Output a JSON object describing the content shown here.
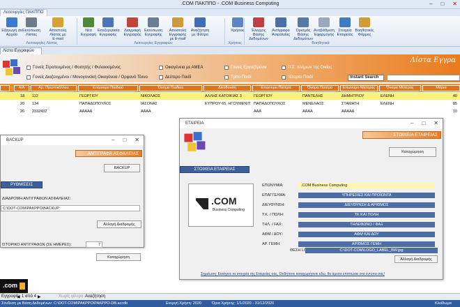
{
  "window": {
    "title": ".COM ΠΑΚΠΠΟ - .COM Business Computing"
  },
  "ribbon_tab": "Λειτουργίες ΠΑΚΠΠΟ",
  "ribbon": {
    "buttons": [
      {
        "label": "Εξαγωγή σε Αρχείο",
        "icon": "export-icon",
        "color": "#3b7ad0"
      },
      {
        "label": "Εκτύπωση Λίστας",
        "icon": "printer-icon",
        "color": "#6d7b8a"
      },
      {
        "label": "Αποστολή Λίστας με E-mail",
        "icon": "email-icon",
        "color": "#d8a233"
      },
      {
        "label": "Νέα Εγγραφή",
        "icon": "new-user-icon",
        "color": "#4c8a3a"
      },
      {
        "label": "Επεξεργασία Εγγραφής",
        "icon": "edit-user-icon",
        "color": "#4f74b5"
      },
      {
        "label": "Διαγραφή Εγγραφής",
        "icon": "delete-user-icon",
        "color": "#c0463b"
      },
      {
        "label": "Εκτύπωση Εγγραφής",
        "icon": "print-record-icon",
        "color": "#6b7d95"
      },
      {
        "label": "Αποστολή Εγγραφής με E-mail",
        "icon": "send-record-icon",
        "color": "#d09a3b"
      },
      {
        "label": "Αναζήτηση με Φίλτρο",
        "icon": "filter-search-icon",
        "color": "#3e6fb5"
      },
      {
        "label": "Χρήσεις",
        "icon": "years-icon",
        "color": "#5f84c6"
      },
      {
        "label": "Έλεγχος Βάσης Δεδομένων",
        "icon": "db-check-icon",
        "color": "#c23f3f"
      },
      {
        "label": "Αντίγραφο Ασφαλείας",
        "icon": "backup-icon",
        "color": "#4a6fa8"
      },
      {
        "label": "Ορισμός Βάσης Δεδομένων",
        "icon": "db-define-icon",
        "color": "#557aa8"
      },
      {
        "label": "Αναβάθμιση Εφαρμογής",
        "icon": "upgrade-icon",
        "color": "#9aa9bb"
      },
      {
        "label": "Στοιχεία Εταιρείας",
        "icon": "company-icon",
        "color": "#3f7bc4"
      },
      {
        "label": "Βοηθητικές Φόρμες",
        "icon": "forms-icon",
        "color": "#d19b37"
      }
    ],
    "groups": [
      "Λειτουργίες Λίστας",
      "Λειτουργίες Εγγραφών",
      "Χρήσεις",
      "Βοηθητικά"
    ]
  },
  "doc_tab": "Λίστα Εγγραφών",
  "list_title": "Λίστα Εγγρα",
  "filters": [
    "Γονείς Στρατευμένος / Φοιτητής / Φυλακισμένος",
    "Οικογένεια με ΑΜΕΑ",
    "Γονείς Εργαζόμενοι",
    "Π.Σ. πλήρων της Οικίας",
    "Γονείς Διαζευγμένοι / Μονογονεϊκή Οικογένεια / Ορφανό Τέκνο",
    "Δεύτερο Παιδί",
    "Τρίτο Παιδί",
    "Τέταρτο Παιδί"
  ],
  "instant_search_label": "Instant Search",
  "table": {
    "headers": [
      "Α/Α",
      "Αρ. Πρωτοκόλλου",
      "Επώνυμο Παιδιού",
      "Όνομα Παιδιού",
      "Διεύθυνση",
      "Επώνυμο Πατέρα",
      "Όνομα Πατέρα",
      "Επώνυμο Μητέρας",
      "Όνομα Μητέρας",
      "Μόρια"
    ],
    "rows": [
      [
        "18",
        "112",
        "ΓΕΩΡΓΙΟΥ",
        "ΝΙΚΟΛΑΟΣ",
        "ΑΛΛΗΣ ΚΑΤΟΙΚΙΑΣ 3",
        "ΓΕΩΡΓΙΟΥ",
        "ΠΑΝΤΕΛΗΣ",
        "ΔΗΜΗΤΡΙΟΥ",
        "ΕΛΕΝΗ",
        "40"
      ],
      [
        "20",
        "134",
        "ΠΑΠΑΔΟΠΟΥΛΟΣ",
        "ΙΑΣΟΝΑΣ",
        "ΚΥΠΡΟΥ 65, ΗΓΟΥΜΕΝΙΤΣΑ",
        "ΠΑΠΑΔΟΠΟΥΛΟΣ",
        "ΜΕΝΕΛΑΟΣ",
        "ΣΤΑΜΑΤΗ",
        "ΕΛΕΝΗ",
        "85"
      ],
      [
        "26",
        "2332432",
        "ΑΑΑΑΑ",
        "ΑΑΑΑ",
        "",
        "ΑΑΑ",
        "ΑΑΑΑ",
        "ΑΑΑΑΑ",
        "",
        "10"
      ]
    ]
  },
  "backup_dialog": {
    "title": "BACKUP",
    "header": "ΑΝΤΙΓΡΑΦΑ ΑΣΦΑΛΕΙΑΣ",
    "backup_btn": "BACKUP",
    "settings_label": "ΡΥΘΜΙΣΕΙΣ",
    "path_label": "ΔΙΑΔΡΟΜΗ ΑΝΤΙΓΡΑΦΩΝ ΑΣΦΑΛΕΙΑΣ:",
    "path_value": "C:\\DOT-COM\\PAKPPO\\BACKUP",
    "change_path_btn": "Αλλαγή Διαδρομής",
    "history_label": "ΙΣΤΟΡΙΚΟ ΑΝΤΙΓΡΑΦΩΝ (ΣΕ ΗΜΕΡΕΣ):",
    "history_value": "7",
    "save_btn": "Καταχώρηση"
  },
  "company_dialog": {
    "title": "ΕΤΑΙΡΕΙΑ",
    "header": "ΣΤΟΙΧΕΙΑ ΕΤΑΙΡΕΙΑΣ",
    "save_btn": "Καταχώρηση",
    "section_label": "ΣΤΟΙΧΕΙΑ ΕΤΑΙΡΕΙΑΣ",
    "logo_text": ".COM",
    "logo_sub": "Business Computing",
    "fields": [
      {
        "label": "ΕΠΩΝΥΜΙΑ:",
        "value": ".COM Business Computing"
      },
      {
        "label": "ΕΠΑΓΓΕΛΜΑ:",
        "value": "ΥΠΗΡΕΣΙΕΣ ΚΑΙ ΠΡΟΪΟΝΤΑ"
      },
      {
        "label": "ΔΙΕΥΘΥΝΣΗ:",
        "value": "ΔΙΕΥΘΥΝΣΗ & ΑΡΙΘΜΟΣ"
      },
      {
        "label": "Τ.Κ. / ΠΟΛΗ:",
        "value": "ΤΚ ΚΑΙ ΠΟΛΗ"
      },
      {
        "label": "ΤΗΛ. / FAX:",
        "value": "ΤΗΛΕΦΩΝΟ / ΦΑΞ"
      },
      {
        "label": "ΑΦΜ / ΔΟΥ.:",
        "value": "ΑΦΜ ΚΑΙ ΔΟΥ"
      },
      {
        "label": "ΑΡ. ΓΕΜΗ:",
        "value": "ΑΡΙΘΜΟΣ ΓΕΜΗ"
      }
    ],
    "logo_path_label": "ΘΕΣΗ LOGO:",
    "logo_path_value": "C:\\DOT-COM\\LOGO_LABEL_BW.jpg",
    "change_path_btn": "Αλλαγή Διαδρομής",
    "note": "Σημείωση: Εισάγετε τα στοιχεία της Εταιρείας σας. Οτιδήποτε καταχωρήσετε εδώ, θα άμεσα επιπτώσει στα έντυπα σας!"
  },
  "record_nav": {
    "label": "Εγγραφή:",
    "position": "1 από 4",
    "no_filter": "Χωρίς φίλτρο",
    "search": "Αναζήτηση"
  },
  "status": {
    "user": "Σύνδεση με Βάση Δεδομένων: C:\\DOT-COM\\PAKPPO\\PAKPPO-DB.accdb",
    "year": "Ενεργή Χρήση: 2020",
    "range": "Όρια Χρήσης: 1/1/2020 - 31/12/2020",
    "right": "Κλείδωμα"
  },
  "bottom_logo": ".com"
}
